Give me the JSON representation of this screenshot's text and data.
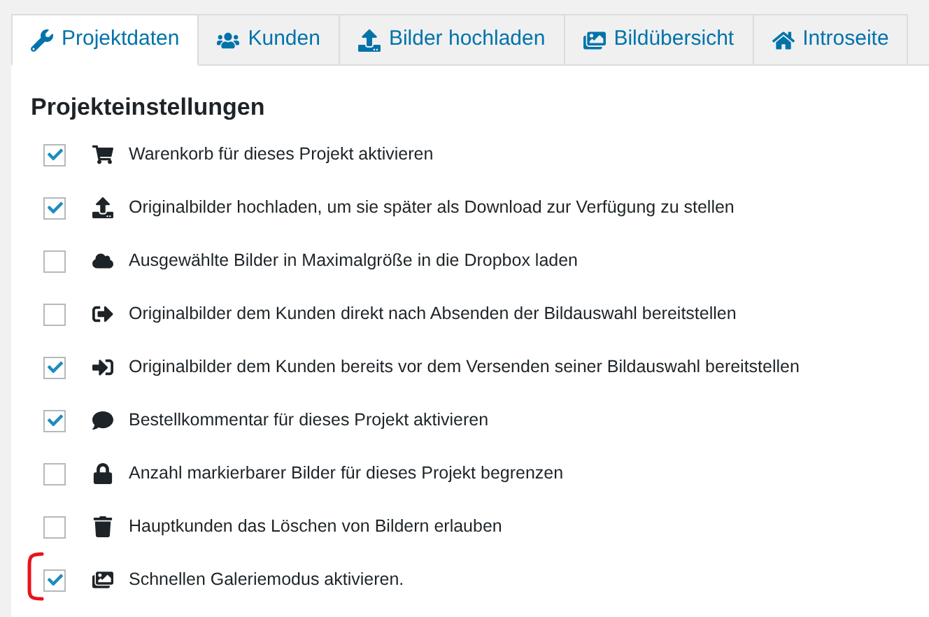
{
  "tabs": [
    {
      "label": "Projektdaten",
      "kind": "wrench",
      "selected": true
    },
    {
      "label": "Kunden",
      "kind": "users",
      "selected": false
    },
    {
      "label": "Bilder hochladen",
      "kind": "upload",
      "selected": false
    },
    {
      "label": "Bildübersicht",
      "kind": "images",
      "selected": false
    },
    {
      "label": "Introseite",
      "kind": "home",
      "selected": false
    }
  ],
  "section": {
    "title": "Projekteinstellungen"
  },
  "settings": [
    {
      "label": "Warenkorb für dieses Projekt aktivieren",
      "kind": "cart",
      "checked": true
    },
    {
      "label": "Originalbilder hochladen, um sie später als Download zur Verfügung zu stellen",
      "kind": "upload",
      "checked": true
    },
    {
      "label": "Ausgewählte Bilder in Maximalgröße in die Dropbox laden",
      "kind": "cloud",
      "checked": false
    },
    {
      "label": "Originalbilder dem Kunden direkt nach Absenden der Bildauswahl bereitstellen",
      "kind": "signout",
      "checked": false
    },
    {
      "label": "Originalbilder dem Kunden bereits vor dem Versenden seiner Bildauswahl bereitstellen",
      "kind": "signin",
      "checked": true
    },
    {
      "label": "Bestellkommentar für dieses Projekt aktivieren",
      "kind": "comment",
      "checked": true
    },
    {
      "label": "Anzahl markierbarer Bilder für dieses Projekt begrenzen",
      "kind": "lock",
      "checked": false
    },
    {
      "label": "Hauptkunden das Löschen von Bildern erlauben",
      "kind": "trash",
      "checked": false
    },
    {
      "label": "Schnellen Galeriemodus aktivieren.",
      "kind": "images",
      "checked": true
    }
  ]
}
